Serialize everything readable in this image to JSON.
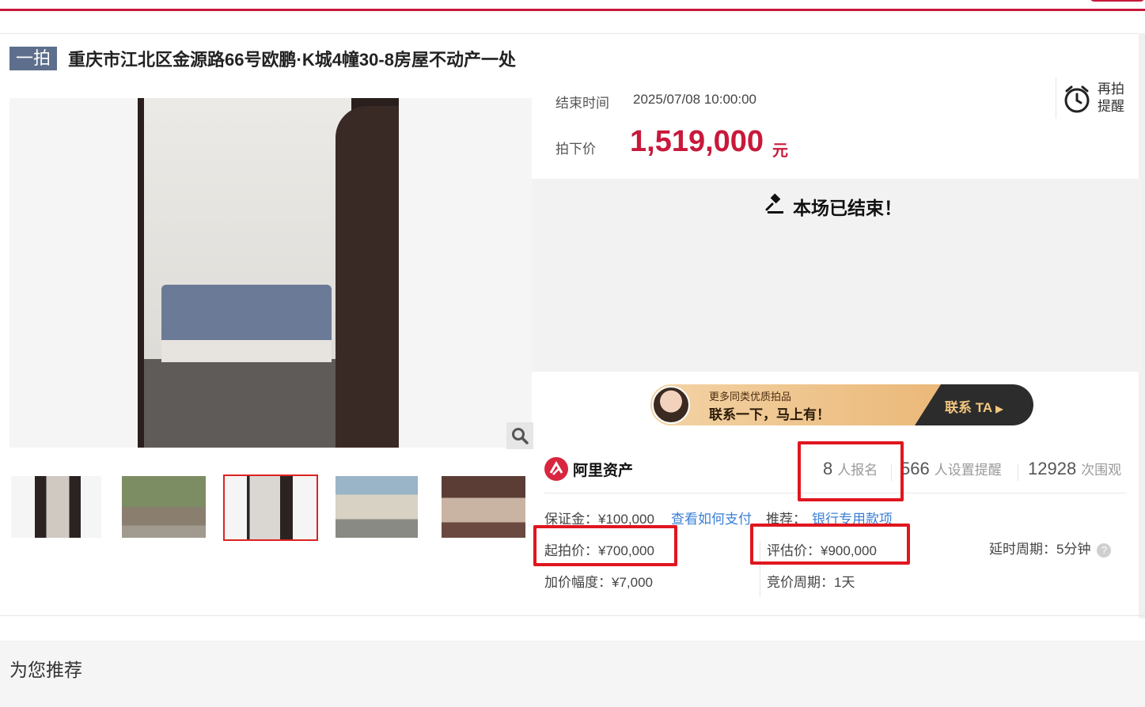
{
  "auction": {
    "tag": "一拍",
    "title": "重庆市江北区金源路66号欧鹏·K城4幢30-8房屋不动产一处"
  },
  "timing": {
    "end_label": "结束时间",
    "end_time": "2025/07/08 10:00:00",
    "price_label": "拍下价",
    "price": "1,519,000",
    "price_unit": "元",
    "remind_label": "再拍提醒"
  },
  "status": {
    "ended_text": "本场已结束！"
  },
  "banner": {
    "line1": "更多同类优质拍品",
    "line2": "联系一下，马上有！",
    "cta": "联系 TA"
  },
  "stats": {
    "brand": "阿里资产",
    "signups": "8",
    "signups_label": "人报名",
    "reminders": "566",
    "reminders_label": "人设置提醒",
    "views": "12928",
    "views_label": "次围观"
  },
  "params": {
    "deposit": "保证金：¥100,000",
    "how_to_pay": "查看如何支付",
    "recommend_label": "推荐：",
    "recommend_link": "银行专用款项",
    "start_price": "起拍价：¥700,000",
    "appraisal": "评估价：¥900,000",
    "extension": "延时周期：5分钟",
    "increment": "加价幅度：¥7,000",
    "bid_period": "竞价周期：1天"
  },
  "recommend_section": {
    "heading": "为您推荐"
  },
  "colors": {
    "accent": "#c8193b",
    "link": "#3a7fd5",
    "highlight_box": "#e0161f"
  }
}
